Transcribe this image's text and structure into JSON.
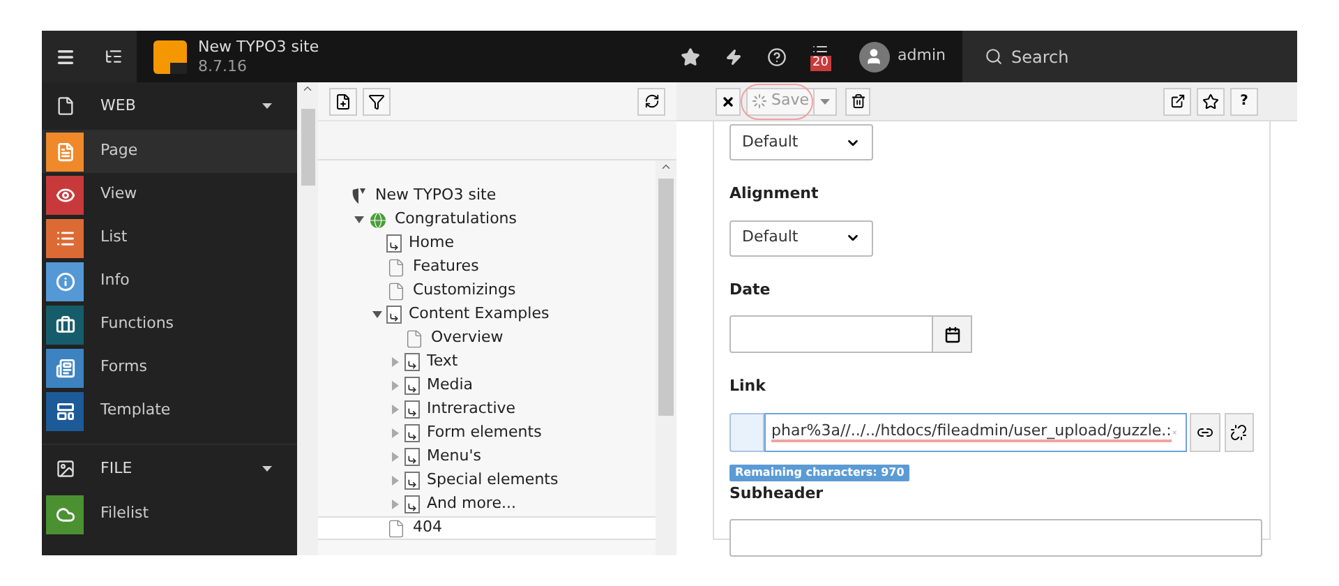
{
  "topbar": {
    "site_title": "New TYPO3 site",
    "version": "8.7.16",
    "notification_count": "20",
    "user": "admin",
    "search": "Search"
  },
  "modules": [
    {
      "group": "WEB",
      "expanded": true,
      "items": [
        {
          "label": "Page",
          "color": "#f0892a",
          "kind": "page",
          "selected": true
        },
        {
          "label": "View",
          "color": "#c8393b",
          "kind": "view",
          "selected": false
        },
        {
          "label": "List",
          "color": "#dc6a35",
          "kind": "list",
          "selected": false
        },
        {
          "label": "Info",
          "color": "#5499d6",
          "kind": "info",
          "selected": false
        },
        {
          "label": "Functions",
          "color": "#165d6b",
          "kind": "functions",
          "selected": false
        },
        {
          "label": "Forms",
          "color": "#3d83c1",
          "kind": "forms",
          "selected": false
        },
        {
          "label": "Template",
          "color": "#1d5a98",
          "kind": "template",
          "selected": false
        }
      ]
    },
    {
      "group": "FILE",
      "expanded": true,
      "items": [
        {
          "label": "Filelist",
          "color": "#4b9132",
          "kind": "cloud",
          "selected": false
        }
      ]
    }
  ],
  "tree": [
    {
      "label": "New TYPO3 site",
      "kind": "site",
      "selected": false,
      "children": [
        {
          "label": "Congratulations",
          "kind": "globe",
          "expanded": true,
          "selected": false,
          "children": [
            {
              "label": "Home",
              "kind": "shortcut",
              "selected": false
            },
            {
              "label": "Features",
              "kind": "page",
              "selected": false
            },
            {
              "label": "Customizings",
              "kind": "page",
              "selected": false
            },
            {
              "label": "Content Examples",
              "kind": "shortcut",
              "expanded": true,
              "selected": false,
              "children": [
                {
                  "label": "Overview",
                  "kind": "page",
                  "selected": false
                },
                {
                  "label": "Text",
                  "kind": "shortcut",
                  "expanded": false,
                  "selected": false
                },
                {
                  "label": "Media",
                  "kind": "shortcut",
                  "expanded": false,
                  "selected": false
                },
                {
                  "label": "Intreractive",
                  "kind": "shortcut",
                  "expanded": false,
                  "selected": false
                },
                {
                  "label": "Form elements",
                  "kind": "shortcut",
                  "expanded": false,
                  "selected": false
                },
                {
                  "label": "Menu's",
                  "kind": "shortcut",
                  "expanded": false,
                  "selected": false
                },
                {
                  "label": "Special elements",
                  "kind": "shortcut",
                  "expanded": false,
                  "selected": false
                },
                {
                  "label": "And more...",
                  "kind": "shortcut",
                  "expanded": false,
                  "selected": false
                }
              ]
            },
            {
              "label": "404",
              "kind": "page",
              "selected": true
            }
          ]
        }
      ]
    }
  ],
  "toolbar": {
    "save": "Save",
    "save_loading": true,
    "help": "?"
  },
  "form": [
    {
      "kind": "select",
      "value": "Default"
    },
    {
      "kind": "select",
      "label": "Alignment",
      "value": "Default"
    },
    {
      "kind": "date",
      "label": "Date"
    },
    {
      "kind": "link",
      "label": "Link",
      "value": "phar%3a//../../htdocs/fileadmin/user_upload/guzzle.:",
      "badge": "Remaining characters: 970"
    },
    {
      "kind": "text",
      "label": "Subheader"
    }
  ]
}
